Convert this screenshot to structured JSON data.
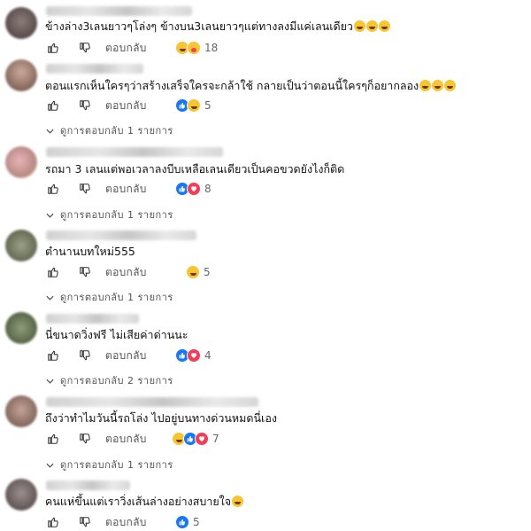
{
  "comments": [
    {
      "text": "ข้างล่าง3เลนยาวๆโล่งๆ ข้างบน3เลนยาวๆแต่ทางลงมีแค่เลนเดียว",
      "emojis": [
        "haha-emoji",
        "haha-emoji",
        "haha-emoji"
      ],
      "reply_label": "ตอบกลับ",
      "reactions": [
        "haha",
        "care"
      ],
      "reaction_count": "18",
      "view_replies": ""
    },
    {
      "text": "ตอนแรกเห็นใครๆว่าสร้างเสร็จใครจะกล้าใช้ กลายเป็นว่าตอนนี้ใครๆก็อยากลอง",
      "emojis": [
        "haha-emoji",
        "haha-emoji",
        "haha-emoji"
      ],
      "reply_label": "ตอบกลับ",
      "reactions": [
        "like",
        "haha"
      ],
      "reaction_count": "5",
      "view_replies": "ดูการตอบกลับ 1 รายการ"
    },
    {
      "text": "รถมา 3 เลนแต่พอเวลาลงบีบเหลือเลนเดียวเป็นคอขวดยังไงก็ติด",
      "emojis": [],
      "reply_label": "ตอบกลับ",
      "reactions": [
        "like",
        "love"
      ],
      "reaction_count": "8",
      "view_replies": "ดูการตอบกลับ 1 รายการ"
    },
    {
      "text": "ตำนานบทใหม่555",
      "emojis": [],
      "reply_label": "ตอบกลับ",
      "reactions": [
        "haha"
      ],
      "reaction_count": "5",
      "view_replies": "ดูการตอบกลับ 1 รายการ"
    },
    {
      "text": "นี่ขนาดวิ่งฟรี ไม่เสียค่าด่านนะ",
      "emojis": [],
      "reply_label": "ตอบกลับ",
      "reactions": [
        "like",
        "love"
      ],
      "reaction_count": "4",
      "view_replies": "ดูการตอบกลับ 2 รายการ"
    },
    {
      "text": "ถึงว่าทำไมวันนี้รถโล่ง ไปอยู่บนทางด่วนหมดนี่เอง",
      "emojis": [],
      "reply_label": "ตอบกลับ",
      "reactions": [
        "haha",
        "like",
        "love"
      ],
      "reaction_count": "7",
      "view_replies": "ดูการตอบกลับ 1 รายการ"
    },
    {
      "text": "คนแห่ขึ้นแต่เราวิ่งเส้นล่างอย่างสบายใจ",
      "emojis": [
        "grin-emoji"
      ],
      "reply_label": "ตอบกลับ",
      "reactions": [
        "like"
      ],
      "reaction_count": "5",
      "view_replies": ""
    }
  ],
  "icons": {
    "like": "thumbs-up-icon",
    "dislike": "thumbs-down-icon",
    "chevron": "chevron-down-icon"
  },
  "colors": {
    "like_blue": "#1877f2",
    "love_red": "#f33e58",
    "haha_yellow": "#f7c531",
    "muted_text": "#65676b"
  }
}
